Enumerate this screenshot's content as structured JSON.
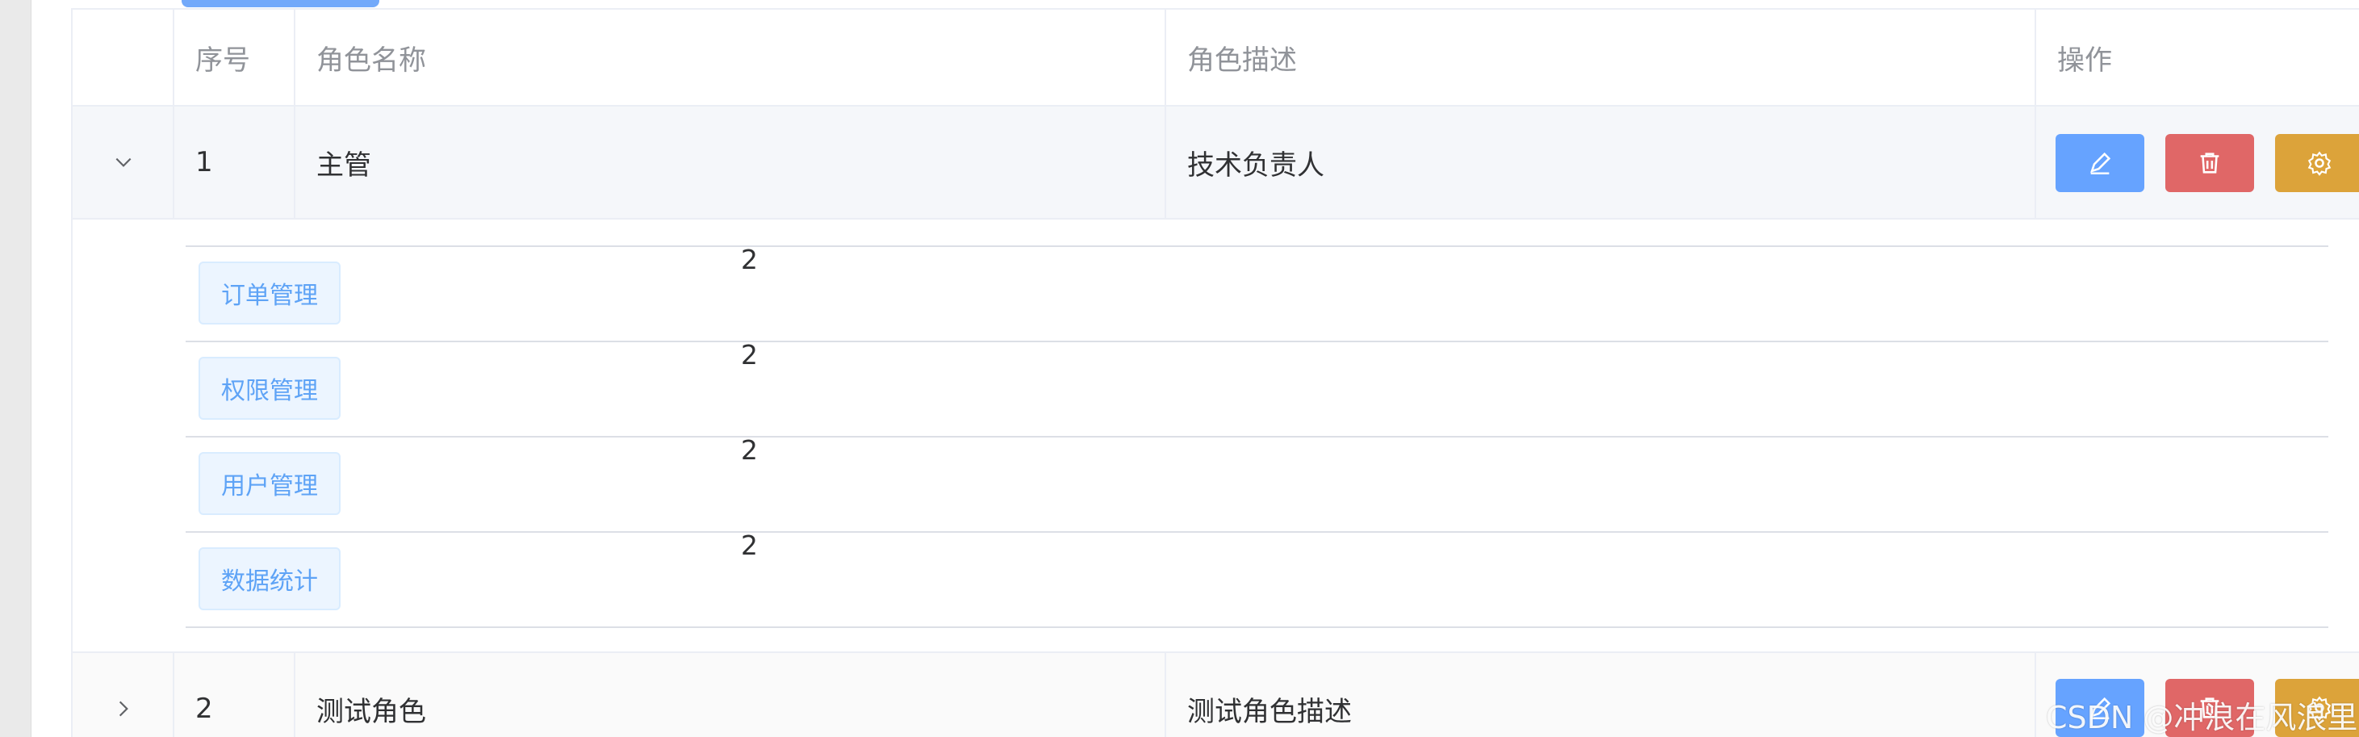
{
  "table": {
    "headers": {
      "index": "序号",
      "role_name": "角色名称",
      "role_desc": "角色描述",
      "actions": "操作"
    },
    "rows": [
      {
        "index": "1",
        "role_name": "主管",
        "role_desc": "技术负责人",
        "expanded": true
      },
      {
        "index": "2",
        "role_name": "测试角色",
        "role_desc": "测试角色描述",
        "expanded": false
      }
    ],
    "expanded_permissions": [
      {
        "label": "订单管理",
        "count": "2"
      },
      {
        "label": "权限管理",
        "count": "2"
      },
      {
        "label": "用户管理",
        "count": "2"
      },
      {
        "label": "数据统计",
        "count": "2"
      }
    ]
  },
  "icons": {
    "expanded_chevron": "chevron-down-icon",
    "collapsed_chevron": "chevron-right-icon",
    "edit": "edit-icon",
    "delete": "delete-icon",
    "settings": "settings-icon"
  },
  "colors": {
    "edit_button": "#66a3ff",
    "delete_button": "#e06767",
    "settings_button": "#dca33a",
    "tag_text": "#5ea3f6",
    "tag_background": "#ecf5ff"
  },
  "watermark": "CSDN @冲浪在风浪里"
}
